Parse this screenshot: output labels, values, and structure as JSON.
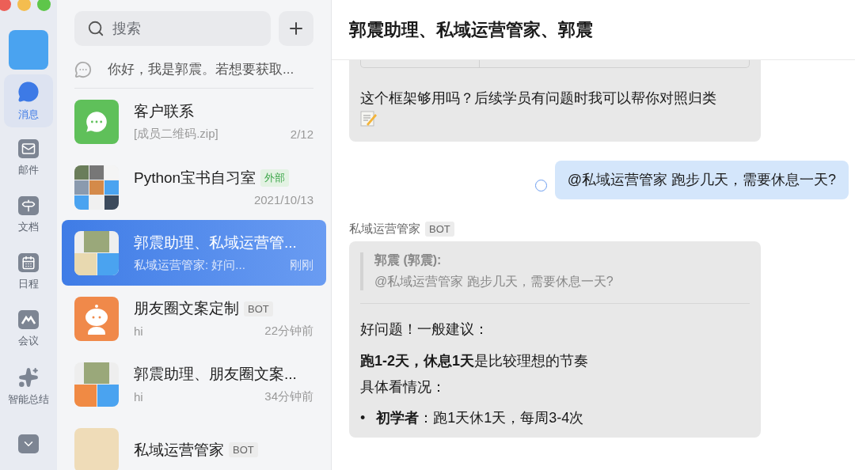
{
  "nav": {
    "items": [
      {
        "kind": "messages",
        "label": "消息",
        "selected": true
      },
      {
        "kind": "mail",
        "label": "邮件",
        "selected": false
      },
      {
        "kind": "docs",
        "label": "文档",
        "selected": false
      },
      {
        "kind": "calendar",
        "label": "日程",
        "selected": false
      },
      {
        "kind": "meeting",
        "label": "会议",
        "selected": false
      },
      {
        "kind": "summary",
        "label": "智能总结",
        "selected": false
      },
      {
        "kind": "more",
        "selected": false
      }
    ]
  },
  "search": {
    "placeholder": "搜索"
  },
  "pinned_notice": "你好，我是郭震。若想要获取...",
  "chats": [
    {
      "kind": "app",
      "name": "客户联系",
      "preview": "[成员二维码.zip]",
      "time": "2/12",
      "selected": false
    },
    {
      "kind": "group9",
      "name": "Python宝书自习室",
      "tag": "外部",
      "time": "2021/10/13",
      "selected": false
    },
    {
      "kind": "group3",
      "name": "郭震助理、私域运营管...",
      "preview": "私域运营管家: 好问...",
      "time": "刚刚",
      "selected": true
    },
    {
      "kind": "bot",
      "name": "朋友圈文案定制",
      "tag": "BOT",
      "preview": "hi",
      "time": "22分钟前",
      "selected": false
    },
    {
      "kind": "group3bot",
      "name": "郭震助理、朋友圈文案...",
      "preview": "hi",
      "time": "34分钟前",
      "selected": false
    },
    {
      "kind": "person",
      "name": "私域运营管家",
      "tag": "BOT",
      "selected": false
    }
  ],
  "chat": {
    "title": "郭震助理、私域运营管家、郭震",
    "messages": [
      {
        "kind": "received",
        "text": "这个框架够用吗？后续学员有问题时我可以帮你对照归类"
      },
      {
        "kind": "sent",
        "text": "@私域运营管家 跑步几天，需要休息一天?"
      },
      {
        "kind": "bot",
        "sender": "私域运营管家",
        "tag": "BOT",
        "quote_author": "郭震 (郭震):",
        "quote_text": "@私域运营管家 跑步几天，需要休息一天?",
        "paragraphs": [
          "好问题！一般建议：",
          "**跑1-2天，休息1天**是比较理想的节奏",
          "具体看情况："
        ],
        "bullets": [
          {
            "marker": "•",
            "text": "**初学者**：跑1天休1天，每周3-4次"
          }
        ]
      }
    ]
  }
}
